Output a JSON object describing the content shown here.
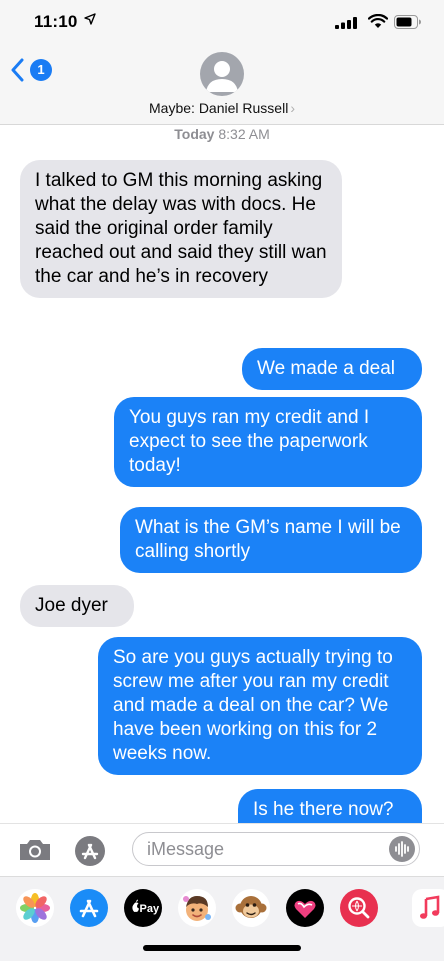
{
  "status_bar": {
    "time": "11:10"
  },
  "header": {
    "back_badge": "1",
    "contact_name": "Maybe: Daniel Russell",
    "contact_chevron": "›"
  },
  "thread": {
    "timestamp_day": "Today",
    "timestamp_time": "8:32 AM",
    "messages": [
      {
        "direction": "incoming",
        "text": "I talked to GM this morning asking what the delay was with docs. He said the original order family reached out and said they still wan the car and he’s in recovery"
      },
      {
        "direction": "outgoing",
        "text": "We made a deal"
      },
      {
        "direction": "outgoing",
        "text": "You guys ran my credit and I expect to see the paperwork today!"
      },
      {
        "direction": "outgoing",
        "text": "What is the GM’s name I will be calling shortly"
      },
      {
        "direction": "incoming",
        "text": "Joe dyer"
      },
      {
        "direction": "outgoing",
        "text": "So are you guys actually trying to screw me after you ran my credit and made a deal on the car? We have been working on this for 2 weeks now."
      },
      {
        "direction": "outgoing",
        "text": "Is he there now?"
      }
    ]
  },
  "input_bar": {
    "placeholder": "iMessage"
  },
  "app_drawer": {
    "apps": [
      {
        "name": "photos-icon"
      },
      {
        "name": "app-store-icon"
      },
      {
        "name": "apple-pay-icon",
        "label": "Pay"
      },
      {
        "name": "memoji-icon"
      },
      {
        "name": "animoji-monkey-icon"
      },
      {
        "name": "digital-touch-icon"
      },
      {
        "name": "web-search-icon"
      },
      {
        "name": "music-icon"
      }
    ]
  },
  "colors": {
    "incoming_bubble": "#e5e5ea",
    "outgoing_bubble": "#1b82f7",
    "accent": "#1a7cf4"
  }
}
